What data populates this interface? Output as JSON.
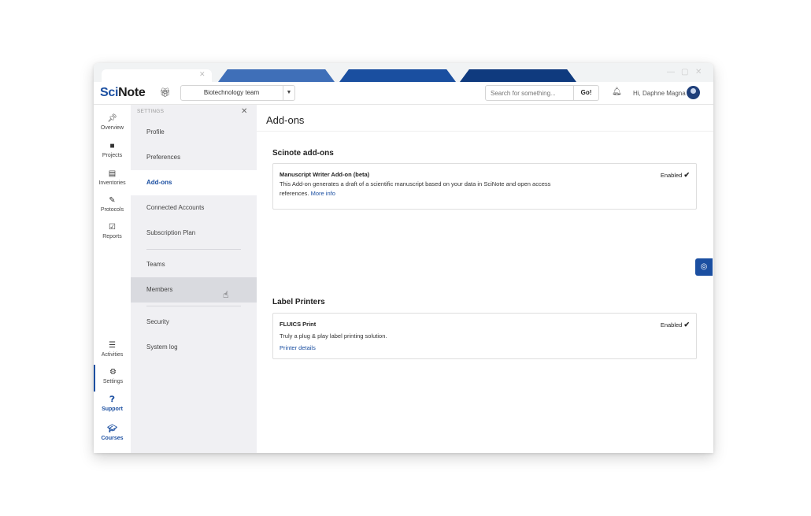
{
  "header": {
    "logo_sci": "Sci",
    "logo_note": "Note",
    "team": "Biotechnology team",
    "search_placeholder": "Search for something...",
    "go_label": "Go!",
    "greeting": "Hi, Daphne Magna"
  },
  "leftnav": {
    "items": [
      {
        "label": "Overview",
        "icon": "pin-icon"
      },
      {
        "label": "Projects",
        "icon": "folder-icon"
      },
      {
        "label": "Inventories",
        "icon": "inventory-icon"
      },
      {
        "label": "Protocols",
        "icon": "edit-icon"
      },
      {
        "label": "Reports",
        "icon": "clipboard-icon"
      },
      {
        "label": "Activities",
        "icon": "list-icon"
      },
      {
        "label": "Settings",
        "icon": "gear-icon"
      },
      {
        "label": "Support",
        "icon": "help-icon"
      },
      {
        "label": "Courses",
        "icon": "graduation-cap-icon"
      }
    ]
  },
  "settings": {
    "title": "SETTINGS",
    "items": [
      "Profile",
      "Preferences",
      "Add-ons",
      "Connected Accounts",
      "Subscription Plan",
      "Teams",
      "Members",
      "Security",
      "System log"
    ],
    "active": "Add-ons",
    "hover": "Members"
  },
  "main": {
    "title": "Add-ons",
    "sections": [
      {
        "heading": "Scinote add-ons",
        "card": {
          "name": "Manuscript Writer Add-on (beta)",
          "desc": "This Add-on generates a draft of a scientific manuscript based on your data in SciNote and open access references.",
          "link": "More info",
          "status": "Enabled"
        }
      },
      {
        "heading": "Label Printers",
        "card": {
          "name": "FLUICS Print",
          "desc": "Truly a plug & play label printing solution.",
          "link": "Printer details",
          "status": "Enabled"
        }
      }
    ]
  },
  "colors": {
    "accent": "#1b4fa1",
    "settings_bg": "#f0f0f3",
    "hover_bg": "#d9dadf"
  }
}
